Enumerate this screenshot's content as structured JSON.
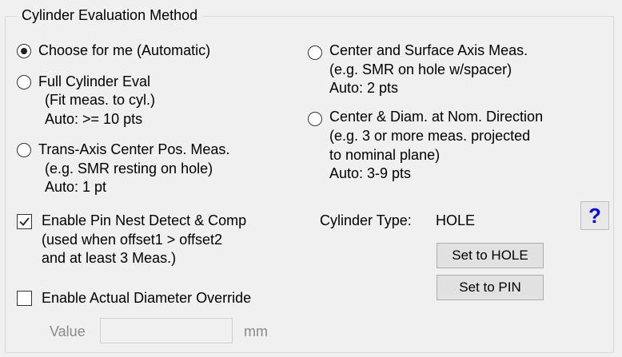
{
  "group": {
    "title": "Cylinder Evaluation Method"
  },
  "radio_options_left": [
    {
      "lines": [
        "Choose for me (Automatic)"
      ],
      "selected": true
    },
    {
      "lines": [
        "Full Cylinder Eval",
        "(Fit meas. to cyl.)",
        "Auto: >= 10 pts"
      ],
      "selected": false
    },
    {
      "lines": [
        "Trans-Axis Center Pos. Meas.",
        "(e.g. SMR resting on hole)",
        "Auto: 1 pt"
      ],
      "selected": false
    }
  ],
  "radio_options_right": [
    {
      "lines": [
        "Center and Surface Axis Meas.",
        "(e.g. SMR on hole w/spacer)",
        "Auto: 2 pts"
      ],
      "selected": false
    },
    {
      "lines": [
        "Center & Diam. at Nom. Direction",
        "(e.g. 3 or more meas. projected",
        "to nominal plane)",
        "Auto: 3-9 pts"
      ],
      "selected": false
    }
  ],
  "pin_nest": {
    "lines": [
      "Enable Pin Nest Detect & Comp",
      "(used when offset1 > offset2",
      "and at least 3 Meas.)"
    ],
    "checked": true
  },
  "diameter_override": {
    "label": "Enable Actual Diameter Override",
    "checked": false
  },
  "value_field": {
    "label": "Value",
    "value": "",
    "unit": "mm"
  },
  "cylinder_type": {
    "label": "Cylinder Type:",
    "value": "HOLE"
  },
  "buttons": {
    "set_hole": "Set to HOLE",
    "set_pin": "Set to PIN"
  },
  "help": {
    "label": "?",
    "color": "#0000e6"
  }
}
